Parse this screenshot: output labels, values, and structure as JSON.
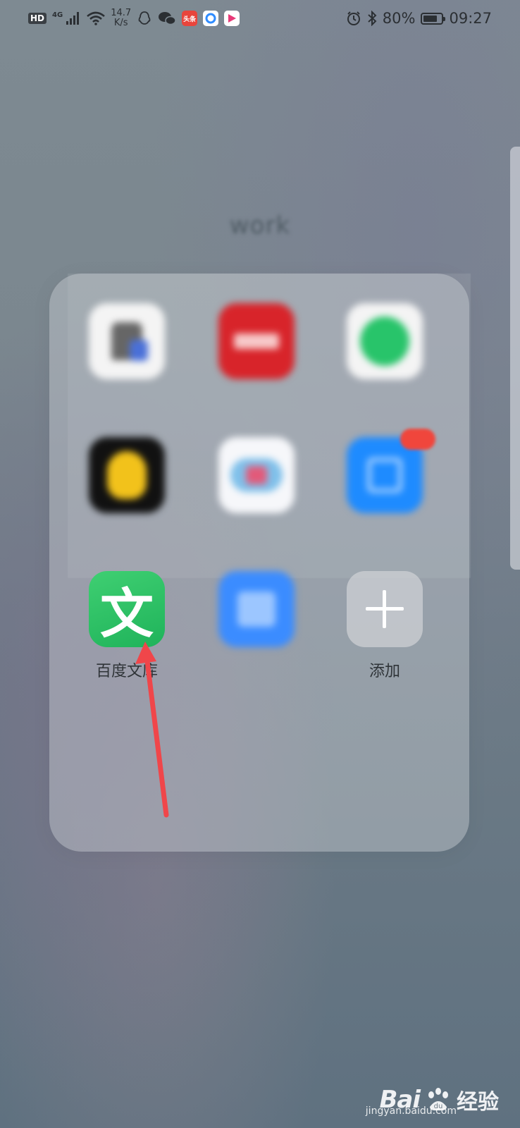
{
  "status_bar": {
    "hd": "HD",
    "network": "4G",
    "speed_value": "14.7",
    "speed_unit": "K/s",
    "mini_app_1": "头条",
    "battery_percent": "80%",
    "battery_level": 0.8,
    "time": "09:27"
  },
  "folder": {
    "title": "work",
    "apps": [
      {
        "label": "百度文库",
        "icon": "baidu-wenku-icon",
        "icon_text": "文"
      },
      {
        "label": "添加",
        "icon": "add-icon"
      }
    ]
  },
  "watermark": {
    "brand": "Bai",
    "brand_suffix": "经验",
    "url": "jingyan.baidu.com"
  },
  "colors": {
    "wenku_green": "#2ec265",
    "arrow_red": "#f0464a"
  }
}
